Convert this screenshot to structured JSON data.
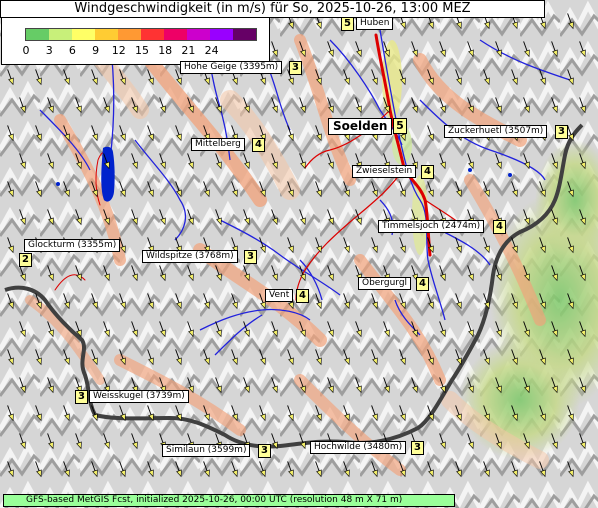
{
  "title": "Windgeschwindigkeit (in m/s) für So, 2025-10-26, 13:00 MEZ",
  "legend": {
    "ticks": [
      "0",
      "3",
      "6",
      "9",
      "12",
      "15",
      "18",
      "21",
      "24"
    ],
    "colors": [
      "#66cc66",
      "#c8f07a",
      "#ffff66",
      "#ffcc33",
      "#ff9933",
      "#ff3333",
      "#ee0066",
      "#cc00cc",
      "#9900ff",
      "#660066"
    ]
  },
  "places": [
    {
      "name": "Huben",
      "value": "5"
    },
    {
      "name": "Hohe Geige (3395m)",
      "value": "3"
    },
    {
      "name": "Soelden",
      "value": "5"
    },
    {
      "name": "Zuckerhuetl (3507m)",
      "value": "3"
    },
    {
      "name": "Mittelberg",
      "value": "4"
    },
    {
      "name": "Zwieselstein",
      "value": "4"
    },
    {
      "name": "Glockturm (3355m)",
      "value": "2"
    },
    {
      "name": "Timmelsjoch (2474m)",
      "value": "4"
    },
    {
      "name": "Wildspitze (3768m)",
      "value": "3"
    },
    {
      "name": "Obergurgl",
      "value": "4"
    },
    {
      "name": "Vent",
      "value": "4"
    },
    {
      "name": "Weisskugel (3739m)",
      "value": "3"
    },
    {
      "name": "Similaun (3599m)",
      "value": "3"
    },
    {
      "name": "Hochwilde (3480m)",
      "value": "3"
    }
  ],
  "footer": "GFS-based MetGIS Fcst, initialized 2025-10-26, 00:00 UTC  (resolution 48 m X 71 m)",
  "colors": {
    "border": "#404040",
    "river": "#2222dd",
    "road": "#dd0000",
    "lake": "#0022cc",
    "footer_bg": "#99ff99",
    "value_bg": "#ffff99"
  }
}
